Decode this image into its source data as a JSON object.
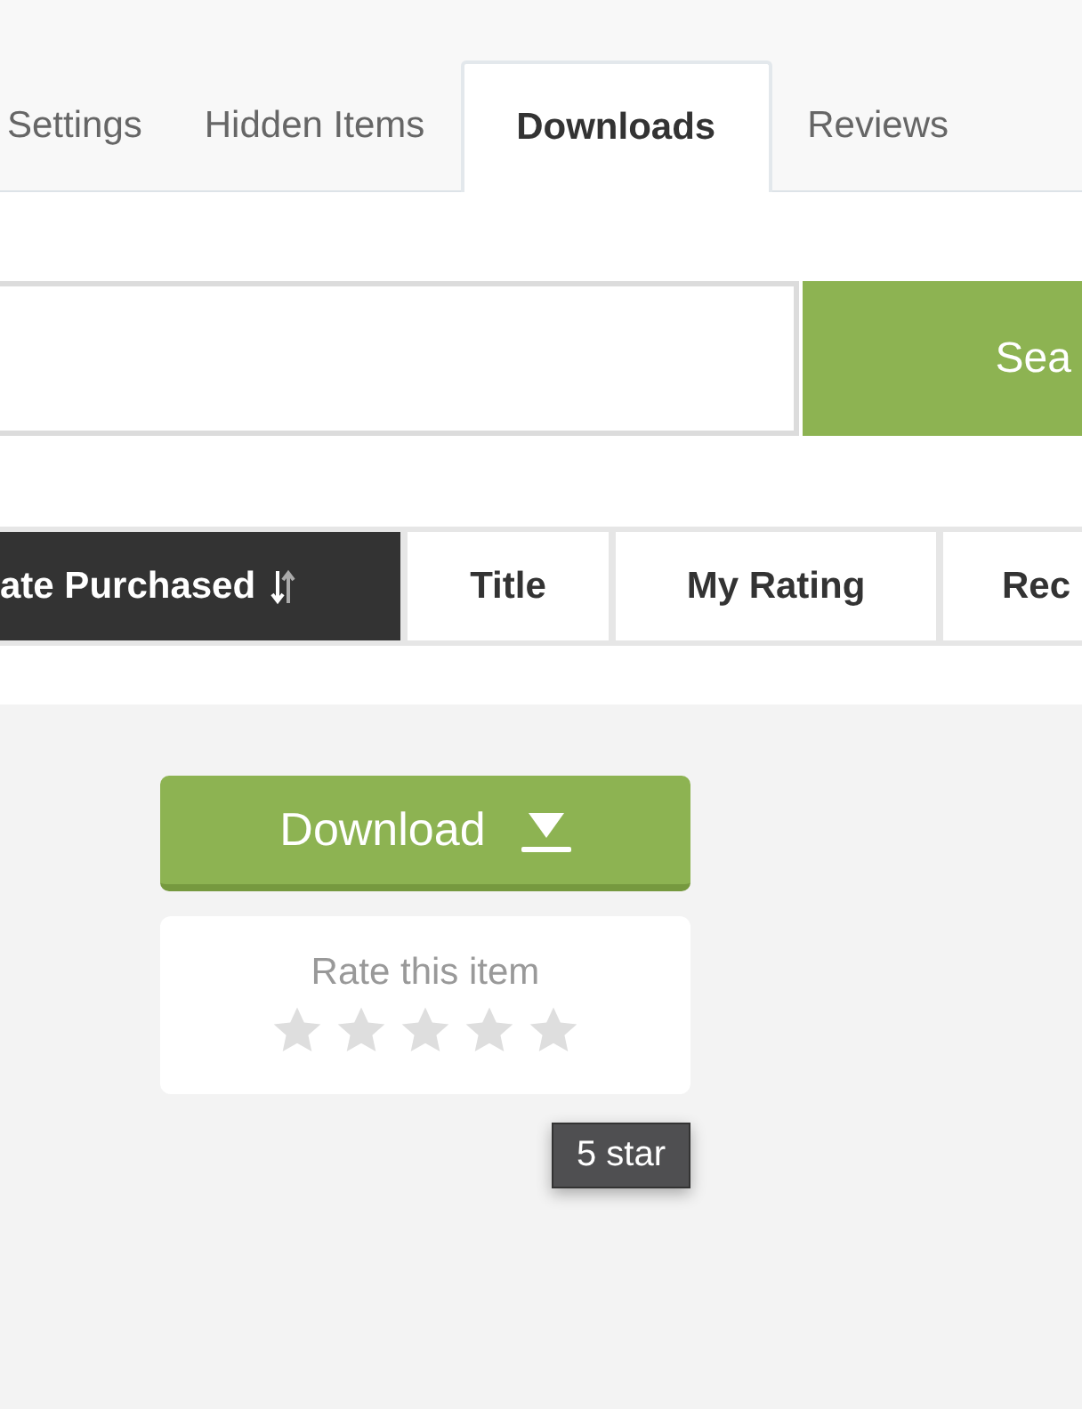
{
  "tabs": [
    {
      "label": "Settings",
      "selected": false
    },
    {
      "label": "Hidden Items",
      "selected": false
    },
    {
      "label": "Downloads",
      "selected": true
    },
    {
      "label": "Reviews",
      "selected": false
    }
  ],
  "search": {
    "button": "Sea"
  },
  "sort_bar": [
    {
      "label": "ate Purchased",
      "selected": true
    },
    {
      "label": "Title",
      "selected": false
    },
    {
      "label": "My Rating",
      "selected": false
    },
    {
      "label": "Rec",
      "selected": false
    }
  ],
  "item": {
    "download_button": "Download",
    "rating": {
      "label": "Rate this item",
      "stars": 0
    },
    "tooltip": "5 star"
  }
}
